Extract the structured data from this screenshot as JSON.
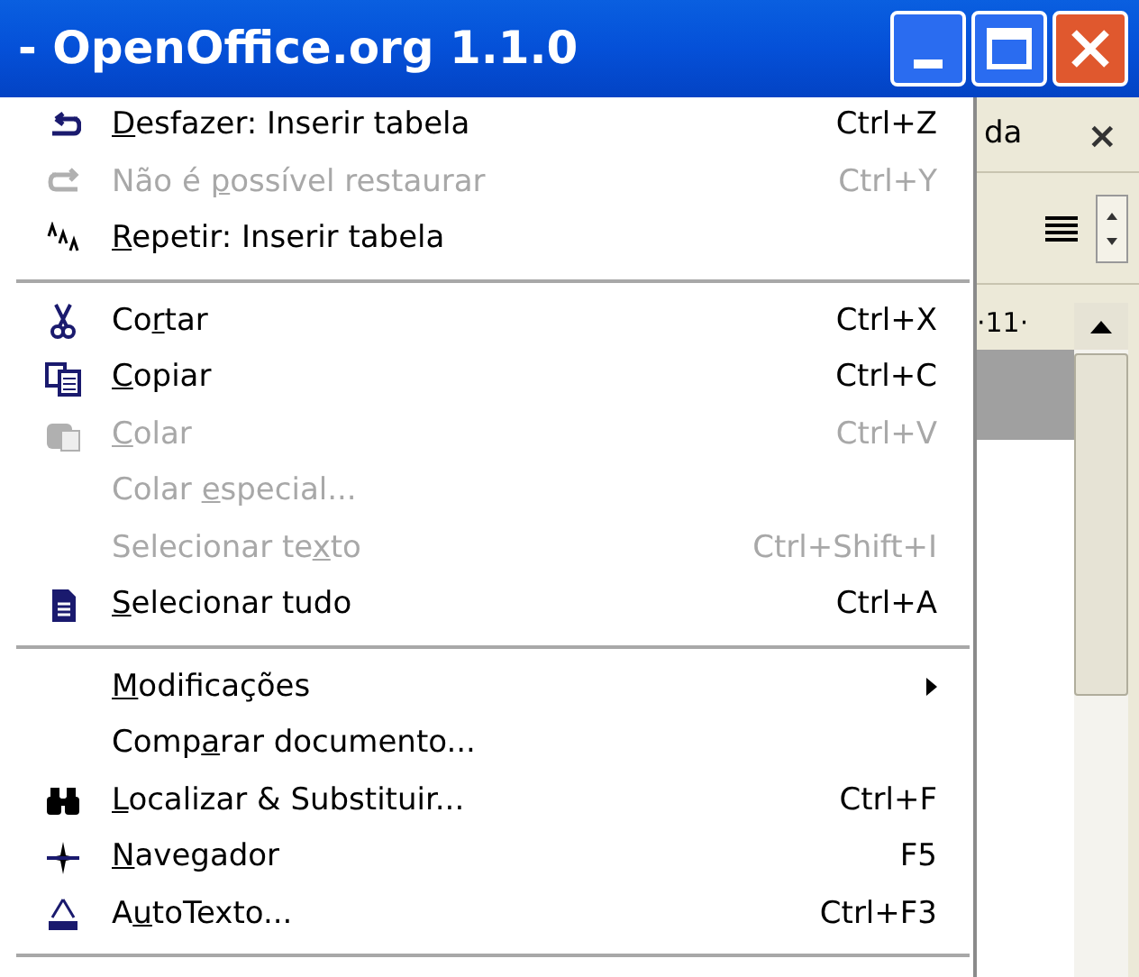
{
  "window": {
    "title": "- OpenOffice.org 1.1.0"
  },
  "background": {
    "tab_text": "da",
    "close_glyph": "×",
    "ruler_text": "·11·"
  },
  "menu": [
    {
      "kind": "item",
      "label": {
        "key": "D",
        "after": "esfazer: Inserir tabela"
      },
      "shortcut": "Ctrl+Z",
      "disabled": false
    },
    {
      "kind": "item",
      "label": {
        "before": "Não é ",
        "key": "p",
        "after": "ossível restaurar"
      },
      "shortcut": "Ctrl+Y",
      "disabled": true
    },
    {
      "kind": "item",
      "label": {
        "key": "R",
        "after": "epetir: Inserir tabela"
      },
      "disabled": false
    },
    {
      "kind": "separator"
    },
    {
      "kind": "item",
      "label": {
        "before": "Co",
        "key": "r",
        "after": "tar"
      },
      "shortcut": "Ctrl+X",
      "disabled": false
    },
    {
      "kind": "item",
      "label": {
        "key": "C",
        "after": "opiar"
      },
      "shortcut": "Ctrl+C",
      "disabled": false
    },
    {
      "kind": "item",
      "label": {
        "key": "C",
        "after": "olar"
      },
      "shortcut": "Ctrl+V",
      "disabled": true
    },
    {
      "kind": "item",
      "label": {
        "before": "Colar ",
        "key": "e",
        "after": "special..."
      },
      "disabled": true
    },
    {
      "kind": "item",
      "label": {
        "before": "Selecionar te",
        "key": "x",
        "after": "to"
      },
      "shortcut": "Ctrl+Shift+I",
      "disabled": true
    },
    {
      "kind": "item",
      "label": {
        "key": "S",
        "after": "elecionar tudo"
      },
      "shortcut": "Ctrl+A",
      "disabled": false
    },
    {
      "kind": "separator"
    },
    {
      "kind": "item",
      "label": {
        "key": "M",
        "after": "odificações"
      },
      "submenu": true,
      "disabled": false
    },
    {
      "kind": "item",
      "label": {
        "before": "Comp",
        "key": "a",
        "after": "rar documento..."
      },
      "disabled": false
    },
    {
      "kind": "item",
      "label": {
        "key": "L",
        "after": "ocalizar & Substituir..."
      },
      "shortcut": "Ctrl+F",
      "disabled": false
    },
    {
      "kind": "item",
      "label": {
        "key": "N",
        "after": "avegador"
      },
      "shortcut": "F5",
      "disabled": false
    },
    {
      "kind": "item",
      "label": {
        "before": "A",
        "key": "u",
        "after": "toTexto..."
      },
      "shortcut": "Ctrl+F3",
      "disabled": false
    },
    {
      "kind": "separator"
    }
  ]
}
